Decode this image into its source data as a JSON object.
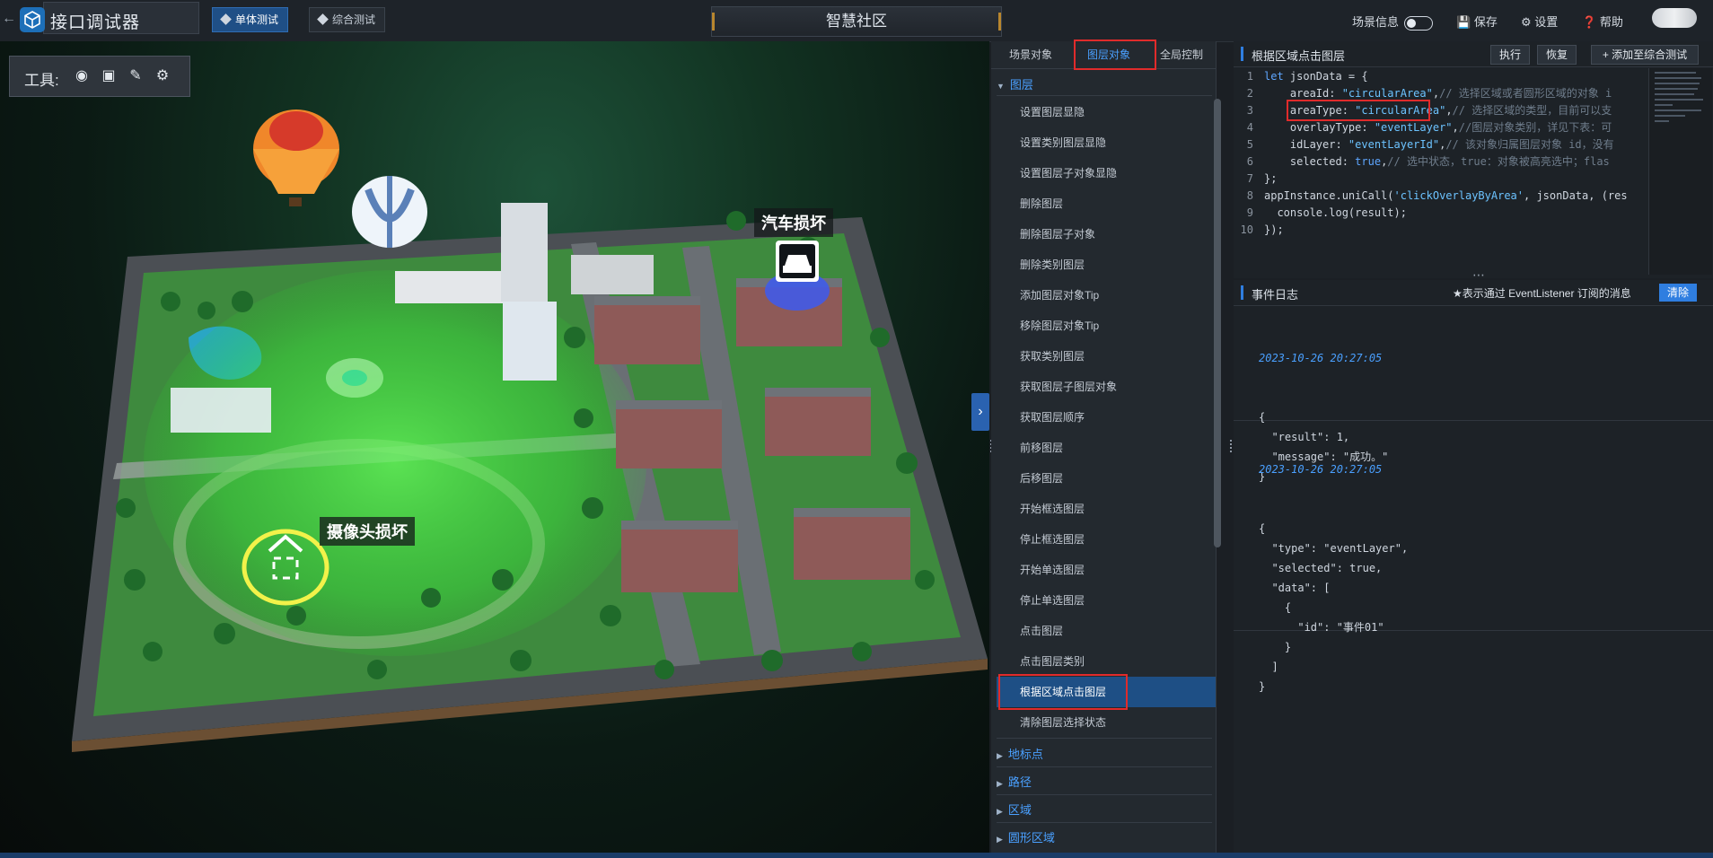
{
  "app": {
    "title": "接口调试器"
  },
  "modes": [
    {
      "label": "单体测试",
      "active": true
    },
    {
      "label": "综合测试",
      "active": false
    }
  ],
  "scene_name": "智慧社区",
  "top_right": {
    "scene_info": "场景信息",
    "save": "保存",
    "settings": "设置",
    "help": "帮助"
  },
  "scene_toolbar": {
    "label": "工具:",
    "tools": [
      "locate-icon",
      "frame-select-icon",
      "pen-icon",
      "gear-icon"
    ]
  },
  "map_labels": {
    "camera": "摄像头损坏",
    "car": "汽车损坏"
  },
  "tabs": [
    {
      "label": "场景对象",
      "active": false
    },
    {
      "label": "图层对象",
      "active": true
    },
    {
      "label": "全局控制",
      "active": false
    }
  ],
  "menu": {
    "open_group": "图层",
    "items": [
      "设置图层显隐",
      "设置类别图层显隐",
      "设置图层子对象显隐",
      "删除图层",
      "删除图层子对象",
      "删除类别图层",
      "添加图层对象Tip",
      "移除图层对象Tip",
      "获取类别图层",
      "获取图层子图层对象",
      "获取图层顺序",
      "前移图层",
      "后移图层",
      "开始框选图层",
      "停止框选图层",
      "开始单选图层",
      "停止单选图层",
      "点击图层",
      "点击图层类别",
      "根据区域点击图层",
      "清除图层选择状态"
    ],
    "selected": "根据区域点击图层",
    "collapsed_groups": [
      "地标点",
      "路径",
      "区域",
      "圆形区域"
    ]
  },
  "code_panel": {
    "title": "根据区域点击图层",
    "buttons": {
      "run": "执行",
      "restore": "恢复",
      "add": "添加至综合测试"
    },
    "lines": [
      {
        "n": "1",
        "parts": [
          [
            "kw",
            "let"
          ],
          [
            "",
            " jsonData = {"
          ]
        ]
      },
      {
        "n": "2",
        "parts": [
          [
            "",
            "    areaId: "
          ],
          [
            "str",
            "\"circularArea\""
          ],
          [
            "",
            ","
          ],
          [
            "cmt",
            "// 选择区域或者圆形区域的对象 i"
          ]
        ]
      },
      {
        "n": "3",
        "parts": [
          [
            "",
            "    areaType: "
          ],
          [
            "str",
            "\"circularArea\""
          ],
          [
            "",
            ","
          ],
          [
            "cmt",
            "// 选择区域的类型，目前可以支"
          ]
        ]
      },
      {
        "n": "4",
        "parts": [
          [
            "",
            "    overlayType: "
          ],
          [
            "str",
            "\"eventLayer\""
          ],
          [
            "",
            ","
          ],
          [
            "cmt",
            "//图层对象类别，详见下表：可"
          ]
        ]
      },
      {
        "n": "5",
        "parts": [
          [
            "",
            "    idLayer: "
          ],
          [
            "str",
            "\"eventLayerId\""
          ],
          [
            "",
            ","
          ],
          [
            "cmt",
            "// 该对象归属图层对象 id，没有"
          ]
        ]
      },
      {
        "n": "6",
        "parts": [
          [
            "",
            "    selected: "
          ],
          [
            "lit",
            "true"
          ],
          [
            "",
            ","
          ],
          [
            "cmt",
            "// 选中状态，true：对象被高亮选中；flas"
          ]
        ]
      },
      {
        "n": "7",
        "parts": [
          [
            "",
            "};"
          ]
        ]
      },
      {
        "n": "8",
        "parts": [
          [
            "",
            "appInstance.uniCall("
          ],
          [
            "str",
            "'clickOverlayByArea'"
          ],
          [
            "",
            ", jsonData, (res"
          ]
        ]
      },
      {
        "n": "9",
        "parts": [
          [
            "",
            "  console.log(result);"
          ]
        ]
      },
      {
        "n": "10",
        "parts": [
          [
            "",
            "});"
          ]
        ]
      }
    ]
  },
  "event_log": {
    "title": "事件日志",
    "note": "★表示通过 EventListener 订阅的消息",
    "clear": "清除",
    "entries": [
      {
        "time": "2023-10-26 20:27:05",
        "body": "{\n  \"result\": 1,\n  \"message\": \"成功。\"\n}"
      },
      {
        "time": "2023-10-26 20:27:05",
        "body": "{\n  \"type\": \"eventLayer\",\n  \"selected\": true,\n  \"data\": [\n    {\n      \"id\": \"事件01\"\n    }\n  ]\n}"
      }
    ]
  }
}
